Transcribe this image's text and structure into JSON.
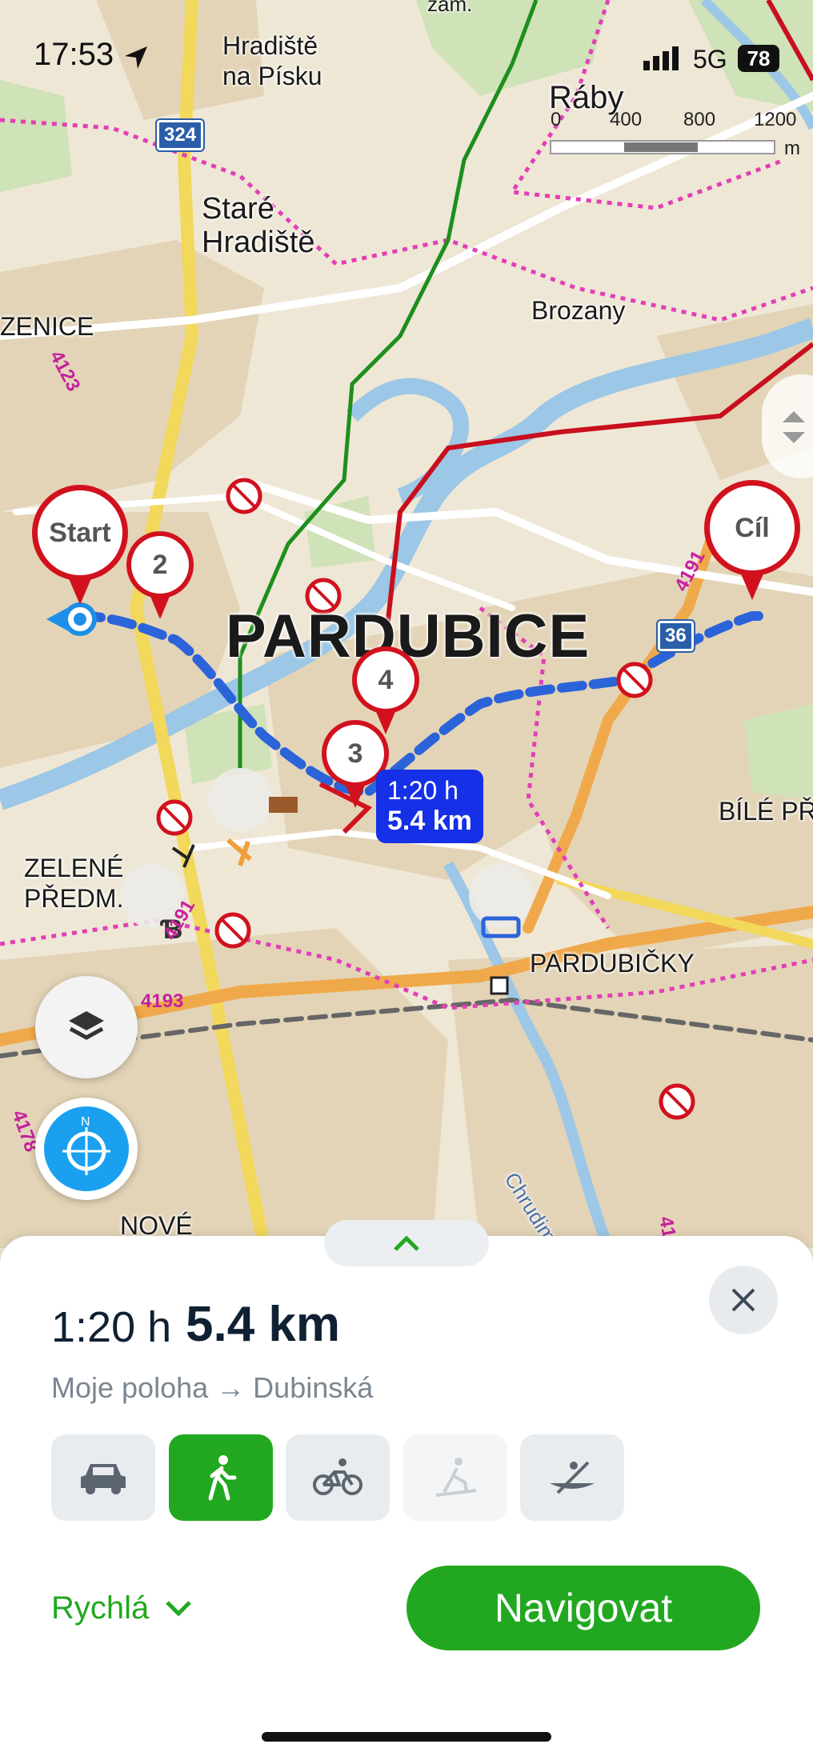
{
  "status_bar": {
    "time": "17:53",
    "network": "5G",
    "battery": "78"
  },
  "map": {
    "city_label": "PARDUBICE",
    "places": [
      {
        "id": "hradiste",
        "text": "Hradiště\nna Písku"
      },
      {
        "id": "stare-hradiste",
        "text": "Staré\nHradiště"
      },
      {
        "id": "raby",
        "text": "Ráby"
      },
      {
        "id": "brozany",
        "text": "Brozany"
      },
      {
        "id": "zenice",
        "text": "ZENICE"
      },
      {
        "id": "zelene-predm",
        "text": "ZELENÉ\nPŘEDM."
      },
      {
        "id": "bile-pr",
        "text": "BÍLÉ PŘ"
      },
      {
        "id": "pardubicky",
        "text": "PARDUBIČKY"
      },
      {
        "id": "nove",
        "text": "NOVÉ"
      },
      {
        "id": "zam",
        "text": "zám."
      },
      {
        "id": "chrudimka",
        "text": "Chrudimka"
      }
    ],
    "road_numbers": [
      "324",
      "36"
    ],
    "road_refs": [
      "4123",
      "4191",
      "4193",
      "4191",
      "4178",
      "41"
    ],
    "scale": {
      "ticks": [
        "0",
        "400",
        "800",
        "1200"
      ],
      "unit": "m"
    },
    "pins": {
      "start": "Start",
      "end": "Cíl",
      "waypoints": [
        "2",
        "3",
        "4"
      ]
    },
    "route_label": {
      "time": "1:20 h",
      "distance": "5.4 km"
    }
  },
  "sheet": {
    "time": "1:20 h",
    "distance": "5.4 km",
    "from": "Moje poloha",
    "arrow": "→",
    "to": "Dubinská",
    "modes": [
      {
        "name": "car",
        "icon": "car-icon",
        "state": "normal"
      },
      {
        "name": "walk",
        "icon": "walk-icon",
        "state": "active"
      },
      {
        "name": "bike",
        "icon": "bike-icon",
        "state": "normal"
      },
      {
        "name": "ski",
        "icon": "ski-icon",
        "state": "disabled"
      },
      {
        "name": "boat",
        "icon": "canoe-icon",
        "state": "normal"
      }
    ],
    "route_type": "Rychlá",
    "navigate_label": "Navigovat"
  },
  "colors": {
    "accent_green": "#21a820",
    "route_blue": "#1530e6",
    "pin_red": "#d1121e"
  }
}
